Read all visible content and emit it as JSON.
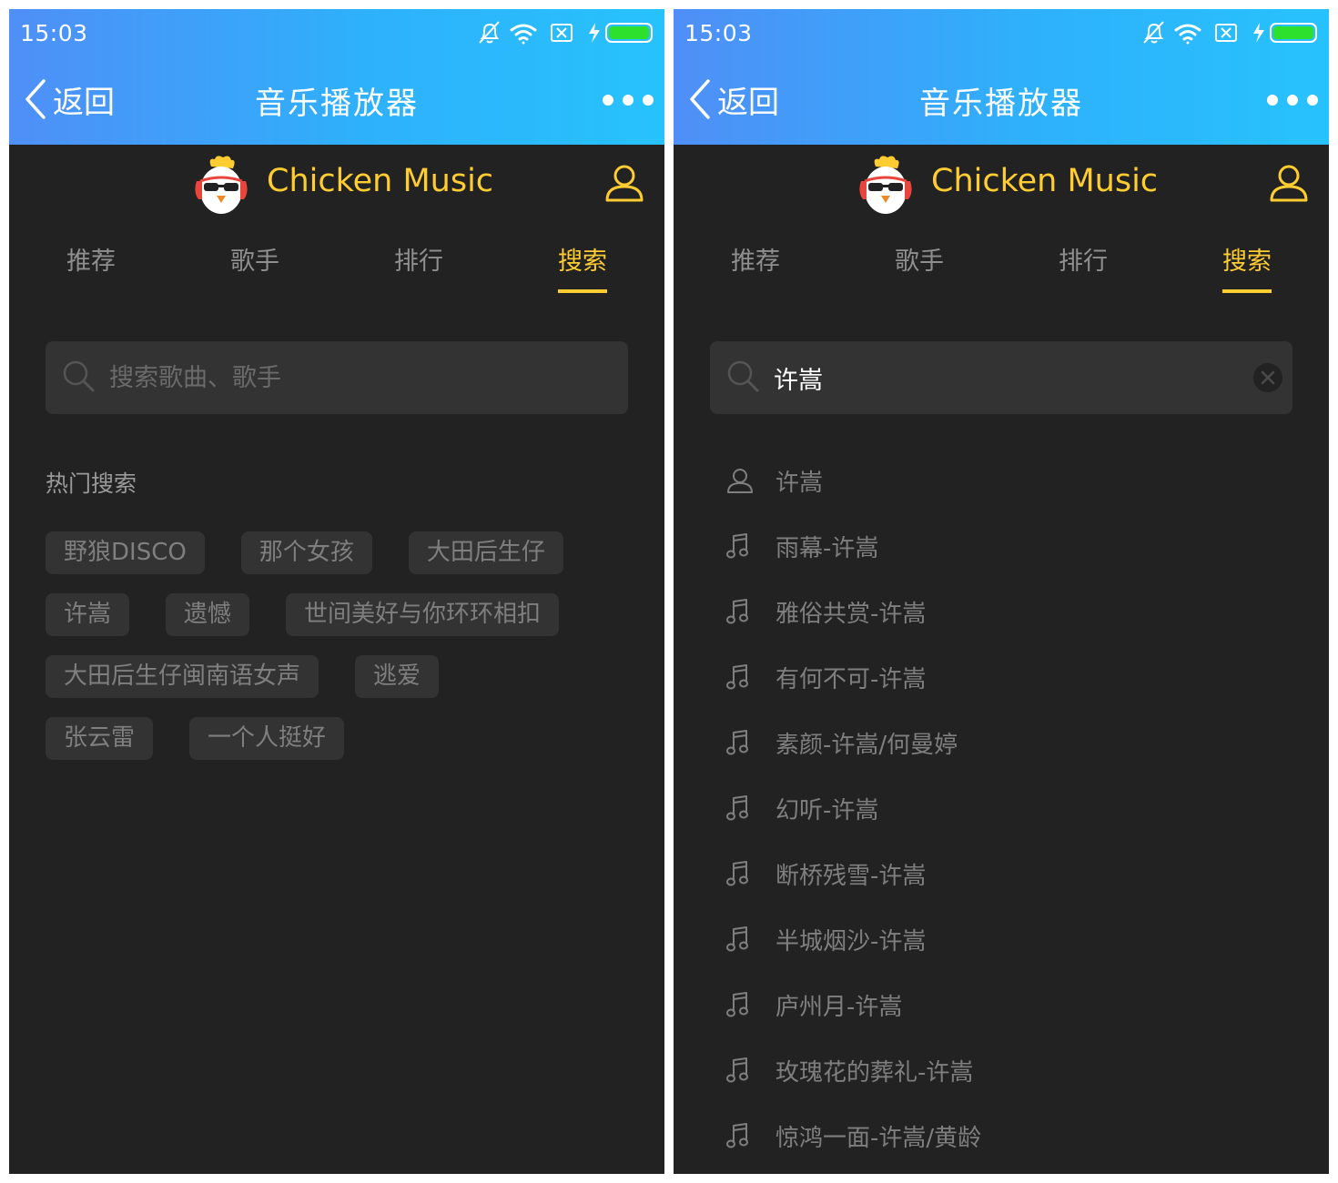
{
  "left": {
    "status": {
      "time": "15:03"
    },
    "titlebar": {
      "back_label": "返回",
      "title": "音乐播放器"
    },
    "header": {
      "brand": "Chicken Music"
    },
    "tabs": [
      "推荐",
      "歌手",
      "排行",
      "搜索"
    ],
    "active_tab": "搜索",
    "search": {
      "placeholder": "搜索歌曲、歌手",
      "value": ""
    },
    "hot": {
      "title": "热门搜索",
      "rows": [
        [
          "野狼DISCO",
          "那个女孩",
          "大田后生仔"
        ],
        [
          "许嵩",
          "遗憾",
          "世间美好与你环环相扣"
        ],
        [
          "大田后生仔闽南语女声",
          "逃爱"
        ],
        [
          "张云雷",
          "一个人挺好"
        ]
      ]
    }
  },
  "right": {
    "status": {
      "time": "15:03"
    },
    "titlebar": {
      "back_label": "返回",
      "title": "音乐播放器"
    },
    "header": {
      "brand": "Chicken Music"
    },
    "tabs": [
      "推荐",
      "歌手",
      "排行",
      "搜索"
    ],
    "active_tab": "搜索",
    "search": {
      "placeholder": "搜索歌曲、歌手",
      "value": "许嵩"
    },
    "suggestions": [
      {
        "type": "singer",
        "icon": "user-icon",
        "text": "许嵩"
      },
      {
        "type": "song",
        "icon": "music-note-icon",
        "text": "雨幕-许嵩"
      },
      {
        "type": "song",
        "icon": "music-note-icon",
        "text": "雅俗共赏-许嵩"
      },
      {
        "type": "song",
        "icon": "music-note-icon",
        "text": "有何不可-许嵩"
      },
      {
        "type": "song",
        "icon": "music-note-icon",
        "text": "素颜-许嵩/何曼婷"
      },
      {
        "type": "song",
        "icon": "music-note-icon",
        "text": "幻听-许嵩"
      },
      {
        "type": "song",
        "icon": "music-note-icon",
        "text": "断桥残雪-许嵩"
      },
      {
        "type": "song",
        "icon": "music-note-icon",
        "text": "半城烟沙-许嵩"
      },
      {
        "type": "song",
        "icon": "music-note-icon",
        "text": "庐州月-许嵩"
      },
      {
        "type": "song",
        "icon": "music-note-icon",
        "text": "玫瑰花的葬礼-许嵩"
      },
      {
        "type": "song",
        "icon": "music-note-icon",
        "text": "惊鸿一面-许嵩/黄龄"
      }
    ]
  },
  "colors": {
    "accent": "#ffcd32",
    "background": "#222222",
    "titlebar_start": "#4f8ff7",
    "titlebar_end": "#27c2fd",
    "tag_bg": "#333333",
    "muted_text": "#7f7f7f"
  }
}
